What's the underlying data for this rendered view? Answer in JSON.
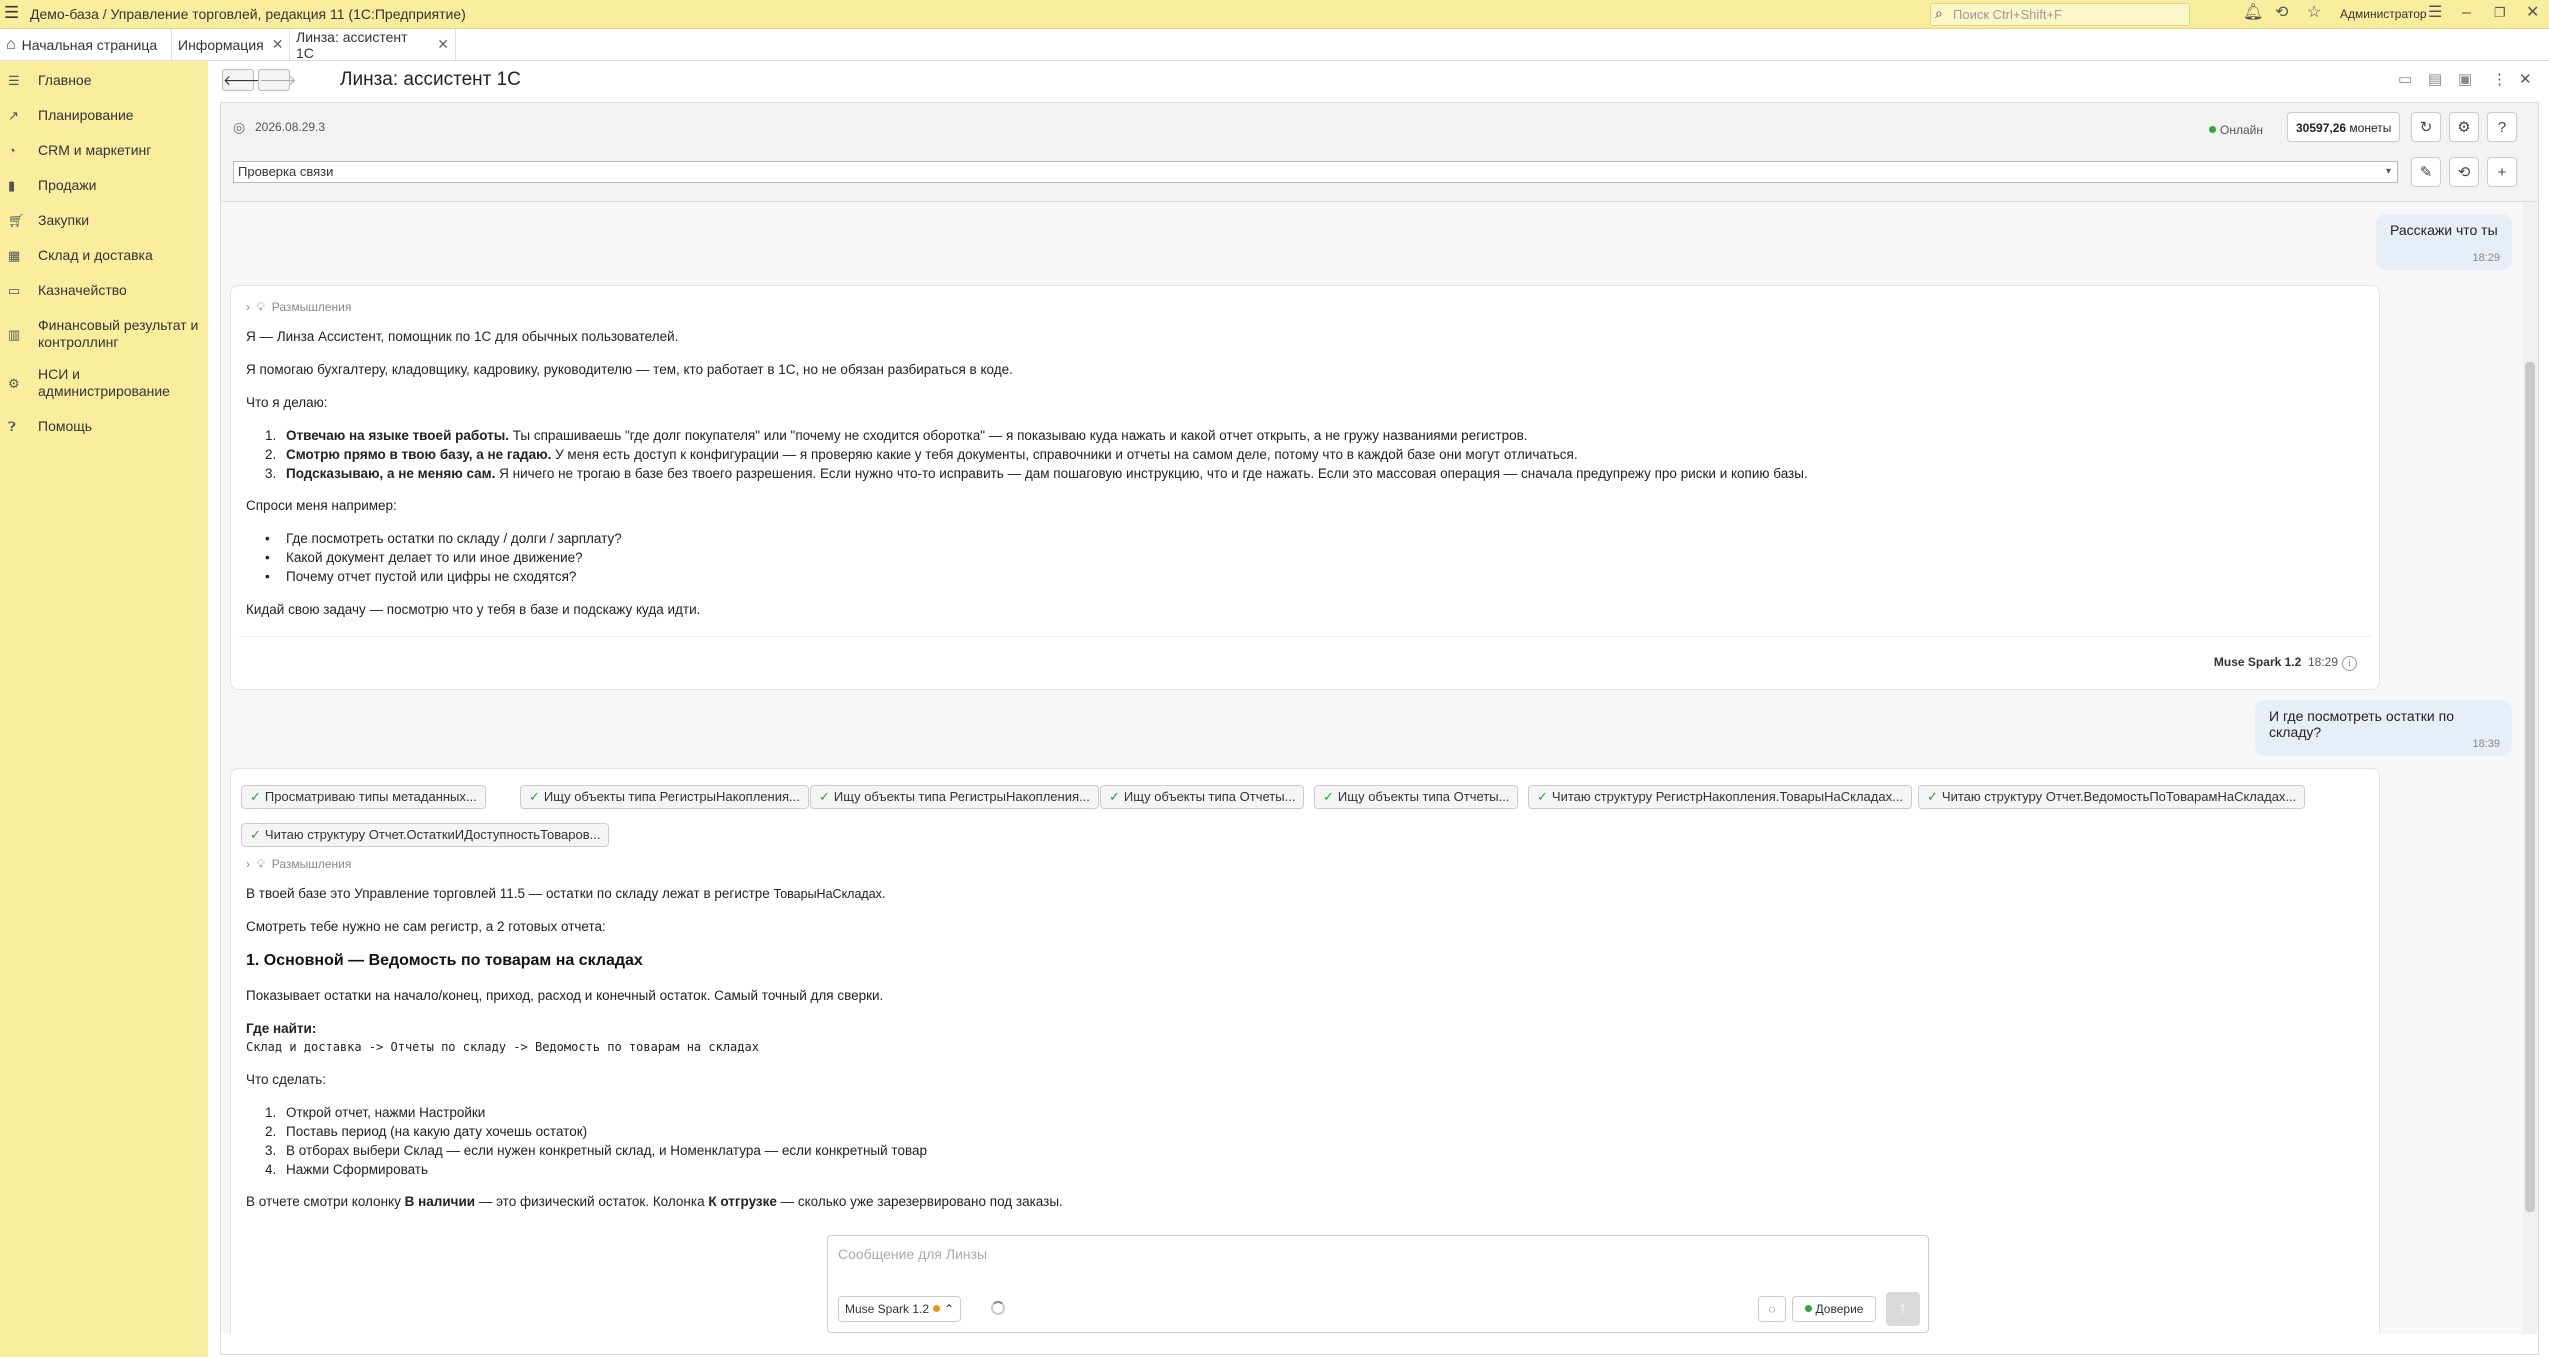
{
  "titlebar": {
    "title": "Демо-база / Управление торговлей, редакция 11  (1С:Предприятие)",
    "search_placeholder": "Поиск Ctrl+Shift+F",
    "user": "Администратор"
  },
  "tabs": [
    {
      "label": "Начальная страница"
    },
    {
      "label": "Информация"
    },
    {
      "label": "Линза: ассистент 1С"
    }
  ],
  "sidebar": {
    "items": [
      {
        "label": "Главное",
        "icon": "menu-icon"
      },
      {
        "label": "Планирование",
        "icon": "planning-icon"
      },
      {
        "label": "CRM и маркетинг",
        "icon": "crm-icon"
      },
      {
        "label": "Продажи",
        "icon": "sales-icon"
      },
      {
        "label": "Закупки",
        "icon": "cart-icon"
      },
      {
        "label": "Склад и доставка",
        "icon": "warehouse-icon"
      },
      {
        "label": "Казначейство",
        "icon": "treasury-icon"
      },
      {
        "label": "Финансовый результат и контроллинг",
        "icon": "finance-icon"
      },
      {
        "label": "НСИ и администрирование",
        "icon": "gear-icon"
      },
      {
        "label": "Помощь",
        "icon": "help-icon"
      }
    ]
  },
  "page": {
    "title": "Линза: ассистент 1С"
  },
  "header": {
    "version": "2026.08.29.3",
    "status": "Онлайн",
    "coins_value": "30597,26",
    "coins_unit": "монеты",
    "dialog": "Проверка связи"
  },
  "chat": {
    "m1": {
      "text": "Расскажи что ты",
      "time": "18:29"
    },
    "a1": {
      "thinking": "Размышления",
      "p1": "Я — Линза Ассистент, помощник по 1С для обычных пользователей.",
      "p2": "Я помогаю бухгалтеру, кладовщику, кадровику, руководителю — тем, кто работает в 1С, но не обязан разбираться в коде.",
      "p3": "Что я делаю:",
      "items": [
        {
          "n": "1.",
          "bold": "Отвечаю на языке твоей работы.",
          "text": " Ты спрашиваешь \"где долг покупателя\" или \"почему не сходится оборотка\" — я показываю куда нажать и какой отчет открыть, а не гружу названиями регистров."
        },
        {
          "n": "2.",
          "bold": "Смотрю прямо в твою базу, а не гадаю.",
          "text": " У меня есть доступ к конфигурации — я проверяю какие у тебя документы, справочники и отчеты на самом деле, потому что в каждой базе они могут отличаться."
        },
        {
          "n": "3.",
          "bold": "Подсказываю, а не меняю сам.",
          "text": " Я ничего не трогаю в базе без твоего разрешения. Если нужно что-то исправить — дам пошаговую инструкцию, что и где нажать. Если это массовая операция — сначала предупрежу про риски и копию базы."
        }
      ],
      "p4": "Спроси меня например:",
      "bullets": [
        "Где посмотреть остатки по складу / долги / зарплату?",
        "Какой документ делает то или иное движение?",
        "Почему отчет пустой или цифры не сходятся?"
      ],
      "p5": "Кидай свою задачу — посмотрю что у тебя в базе и подскажу куда идти.",
      "model": "Muse Spark 1.2",
      "time": "18:29"
    },
    "m2": {
      "text": "И где посмотреть остатки по складу?",
      "time": "18:39"
    },
    "a2": {
      "chips": [
        "Просматриваю типы метаданных...",
        "Ищу объекты типа РегистрыНакопления...",
        "Ищу объекты типа РегистрыНакопления...",
        "Ищу объекты типа Отчеты...",
        "Ищу объекты типа Отчеты...",
        "Читаю структуру РегистрНакопления.ТоварыНаСкладах...",
        "Читаю структуру Отчет.ВедомостьПоТоварамНаСкладах...",
        "Читаю структуру Отчет.ОстаткиИДоступностьТоваров..."
      ],
      "thinking": "Размышления",
      "p1a": "В твоей базе это Управление торговлей 11.5 — остатки по складу лежат в регистре ",
      "p1b": "ТоварыНаСкладах",
      "p1c": ".",
      "p2": "Смотреть тебе нужно не сам регистр, а 2 готовых отчета:",
      "h": "1. Основной — Ведомость по товарам на складах",
      "p3": "Показывает остатки на начало/конец, приход, расход и конечный остаток. Самый точный для сверки.",
      "where": "Где найти:",
      "path": "Склад и доставка -> Отчеты по складу -> Ведомость по товарам на складах",
      "todo": "Что сделать:",
      "steps": [
        {
          "n": "1.",
          "text": "Открой отчет, нажми Настройки"
        },
        {
          "n": "2.",
          "text": "Поставь период (на какую дату хочешь остаток)"
        },
        {
          "n": "3.",
          "text": "В отборах выбери Склад — если нужен конкретный склад, и Номенклатура — если конкретный товар"
        },
        {
          "n": "4.",
          "text": "Нажми Сформировать"
        }
      ],
      "f1": "В отчете смотри колонку ",
      "f2": "В наличии",
      "f3": " — это физический остаток. Колонка ",
      "f4": "К отгрузке",
      "f5": " — сколько уже зарезервировано под заказы."
    }
  },
  "composer": {
    "placeholder": "Сообщение для Линзы",
    "model": "Muse Spark 1.2",
    "trust": "Доверие"
  }
}
